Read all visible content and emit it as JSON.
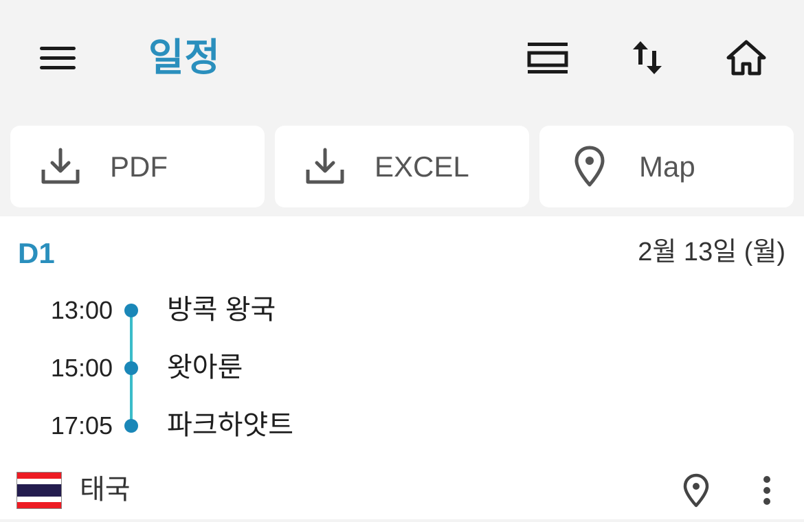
{
  "header": {
    "title": "일정",
    "icons": {
      "menu": "hamburger-menu-icon",
      "view": "view-agenda-icon",
      "sort": "swap-vertical-icon",
      "home": "home-icon"
    }
  },
  "actions": [
    {
      "label": "PDF",
      "icon": "download-icon"
    },
    {
      "label": "EXCEL",
      "icon": "download-icon"
    },
    {
      "label": "Map",
      "icon": "location-pin-icon"
    }
  ],
  "day": {
    "label": "D1",
    "date": "2월 13일 (월)",
    "schedule": [
      {
        "time": "13:00",
        "place": "방콕 왕국"
      },
      {
        "time": "15:00",
        "place": "왓아룬"
      },
      {
        "time": "17:05",
        "place": "파크하얏트"
      }
    ],
    "country": "태국",
    "country_flag": "thailand-flag",
    "flag_colors": [
      "#ed1c24",
      "#ffffff",
      "#241d4f",
      "#ffffff",
      "#ed1c24"
    ]
  },
  "colors": {
    "accent": "#2a8fbd",
    "timeline_line": "#3bbcc9",
    "timeline_dot": "#1a87b8",
    "background": "#f3f3f3",
    "card": "#ffffff"
  }
}
